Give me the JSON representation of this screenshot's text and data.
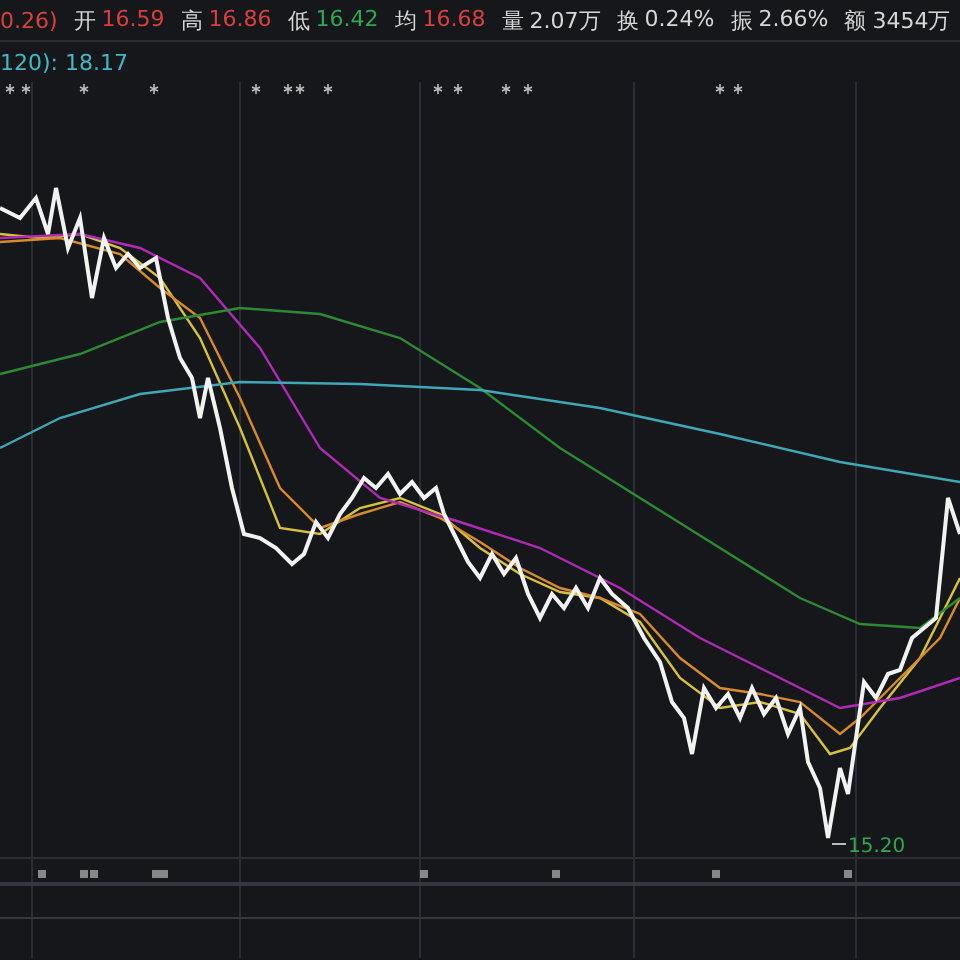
{
  "quote_bar": {
    "items": [
      {
        "value": "0.26)",
        "color": "#d93f3f"
      },
      {
        "label": "开",
        "value": "16.59",
        "color": "#d93f3f"
      },
      {
        "label": "高",
        "value": "16.86",
        "color": "#d93f3f"
      },
      {
        "label": "低",
        "value": "16.42",
        "color": "#2fa84f"
      },
      {
        "label": "均",
        "value": "16.68",
        "color": "#d93f3f"
      },
      {
        "label": "量",
        "value": "2.07万",
        "color": "#d6d6d6"
      },
      {
        "label": "换",
        "value": "0.24%",
        "color": "#d6d6d6"
      },
      {
        "label": "振",
        "value": "2.66%",
        "color": "#d6d6d6"
      },
      {
        "label": "额",
        "value": "3454万",
        "color": "#d6d6d6"
      }
    ]
  },
  "ma_legend": {
    "text": "120): 18.17"
  },
  "chart": {
    "low_label": "15.20"
  }
}
